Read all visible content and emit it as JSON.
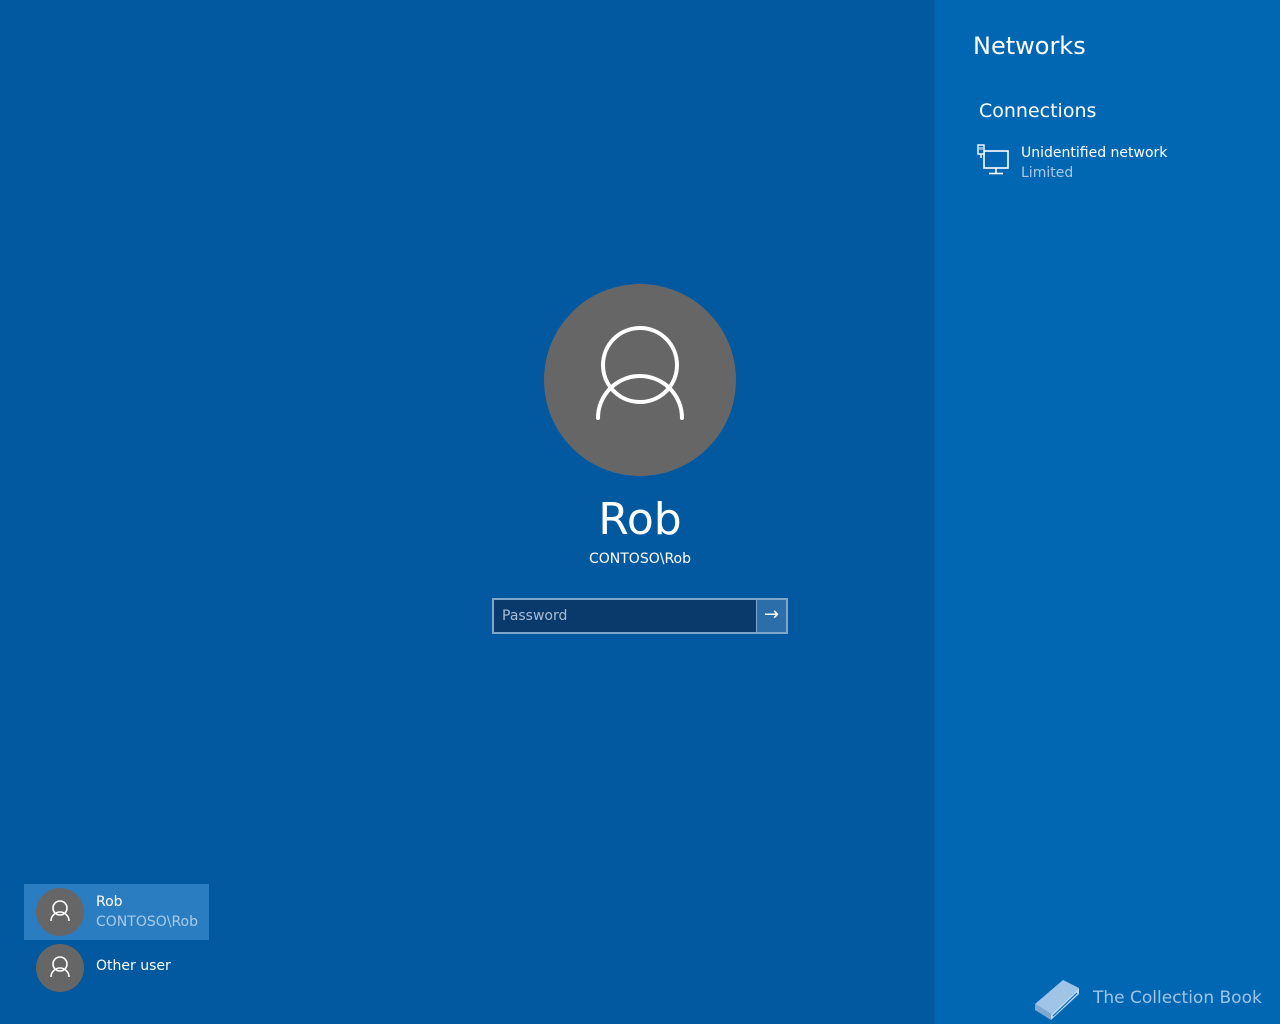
{
  "networks_panel": {
    "title": "Networks",
    "section_label": "Connections",
    "connection": {
      "name": "Unidentified network",
      "status": "Limited",
      "icon": "wired-network-icon"
    }
  },
  "login": {
    "user_name": "Rob",
    "user_domain": "CONTOSO\\Rob",
    "password_placeholder": "Password",
    "submit_icon": "arrow-right-icon",
    "submit_glyph": "→"
  },
  "user_list": [
    {
      "name": "Rob",
      "domain": "CONTOSO\\Rob",
      "selected": true
    },
    {
      "name": "Other user",
      "selected": false
    }
  ],
  "watermark": {
    "text": "The Collection Book",
    "icon": "book-icon"
  },
  "colors": {
    "background": "#02599f",
    "panel": "#0267b3",
    "avatar": "#666666",
    "selected_user": "#2a7dc1"
  }
}
